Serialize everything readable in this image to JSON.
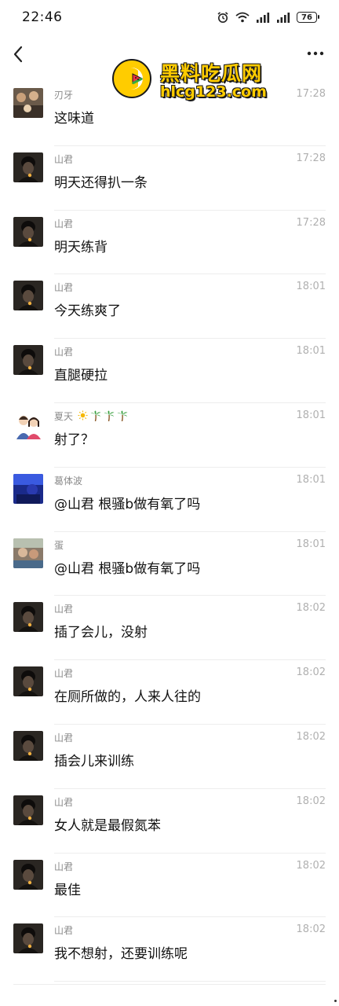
{
  "status_bar": {
    "time": "22:46",
    "battery": "76",
    "icons": [
      "alarm-icon",
      "wifi-icon",
      "signal-icon",
      "signal-icon",
      "battery-icon"
    ]
  },
  "nav": {
    "back_icon": "chevron-left-icon",
    "more_icon": "more-dots-icon"
  },
  "watermark": {
    "title": "黑料吃瓜网",
    "url": "hlcg123.com",
    "colors": {
      "text": "#ffcc00",
      "outline": "#1a1a1a"
    }
  },
  "messages": [
    {
      "name": "刃牙",
      "time": "17:28",
      "text": "这味道",
      "avatar": "photo-avatar-a"
    },
    {
      "name": "山君",
      "time": "17:28",
      "text": "明天还得扒一条",
      "avatar": "dark-avatar"
    },
    {
      "name": "山君",
      "time": "17:28",
      "text": "明天练背",
      "avatar": "dark-avatar"
    },
    {
      "name": "山君",
      "time": "18:01",
      "text": "今天练爽了",
      "avatar": "dark-avatar"
    },
    {
      "name": "山君",
      "time": "18:01",
      "text": "直腿硬拉",
      "avatar": "dark-avatar"
    },
    {
      "name": "夏天",
      "time": "18:01",
      "text": "射了？",
      "avatar": "cartoon-avatar",
      "name_emojis": [
        "sun-icon",
        "palm-tree-icon",
        "palm-tree-icon",
        "palm-tree-icon"
      ]
    },
    {
      "name": "葛体波",
      "time": "18:01",
      "text": "@山君 根骚b做有氧了吗",
      "avatar": "blue-avatar"
    },
    {
      "name": "蛋",
      "time": "18:01",
      "text": "@山君 根骚b做有氧了吗",
      "avatar": "photo-avatar-b"
    },
    {
      "name": "山君",
      "time": "18:02",
      "text": "插了会儿，没射",
      "avatar": "dark-avatar"
    },
    {
      "name": "山君",
      "time": "18:02",
      "text": "在厕所做的，人来人往的",
      "avatar": "dark-avatar"
    },
    {
      "name": "山君",
      "time": "18:02",
      "text": "插会儿来训练",
      "avatar": "dark-avatar"
    },
    {
      "name": "山君",
      "time": "18:02",
      "text": "女人就是最假氮苯",
      "avatar": "dark-avatar"
    },
    {
      "name": "山君",
      "time": "18:02",
      "text": "最佳",
      "avatar": "dark-avatar"
    },
    {
      "name": "山君",
      "time": "18:02",
      "text": "我不想射，还要训练呢",
      "avatar": "dark-avatar"
    }
  ],
  "colors": {
    "name": "#8a8a8a",
    "time": "#b0b0b0",
    "text": "#111111",
    "divider": "#ededed",
    "background": "#ffffff"
  }
}
